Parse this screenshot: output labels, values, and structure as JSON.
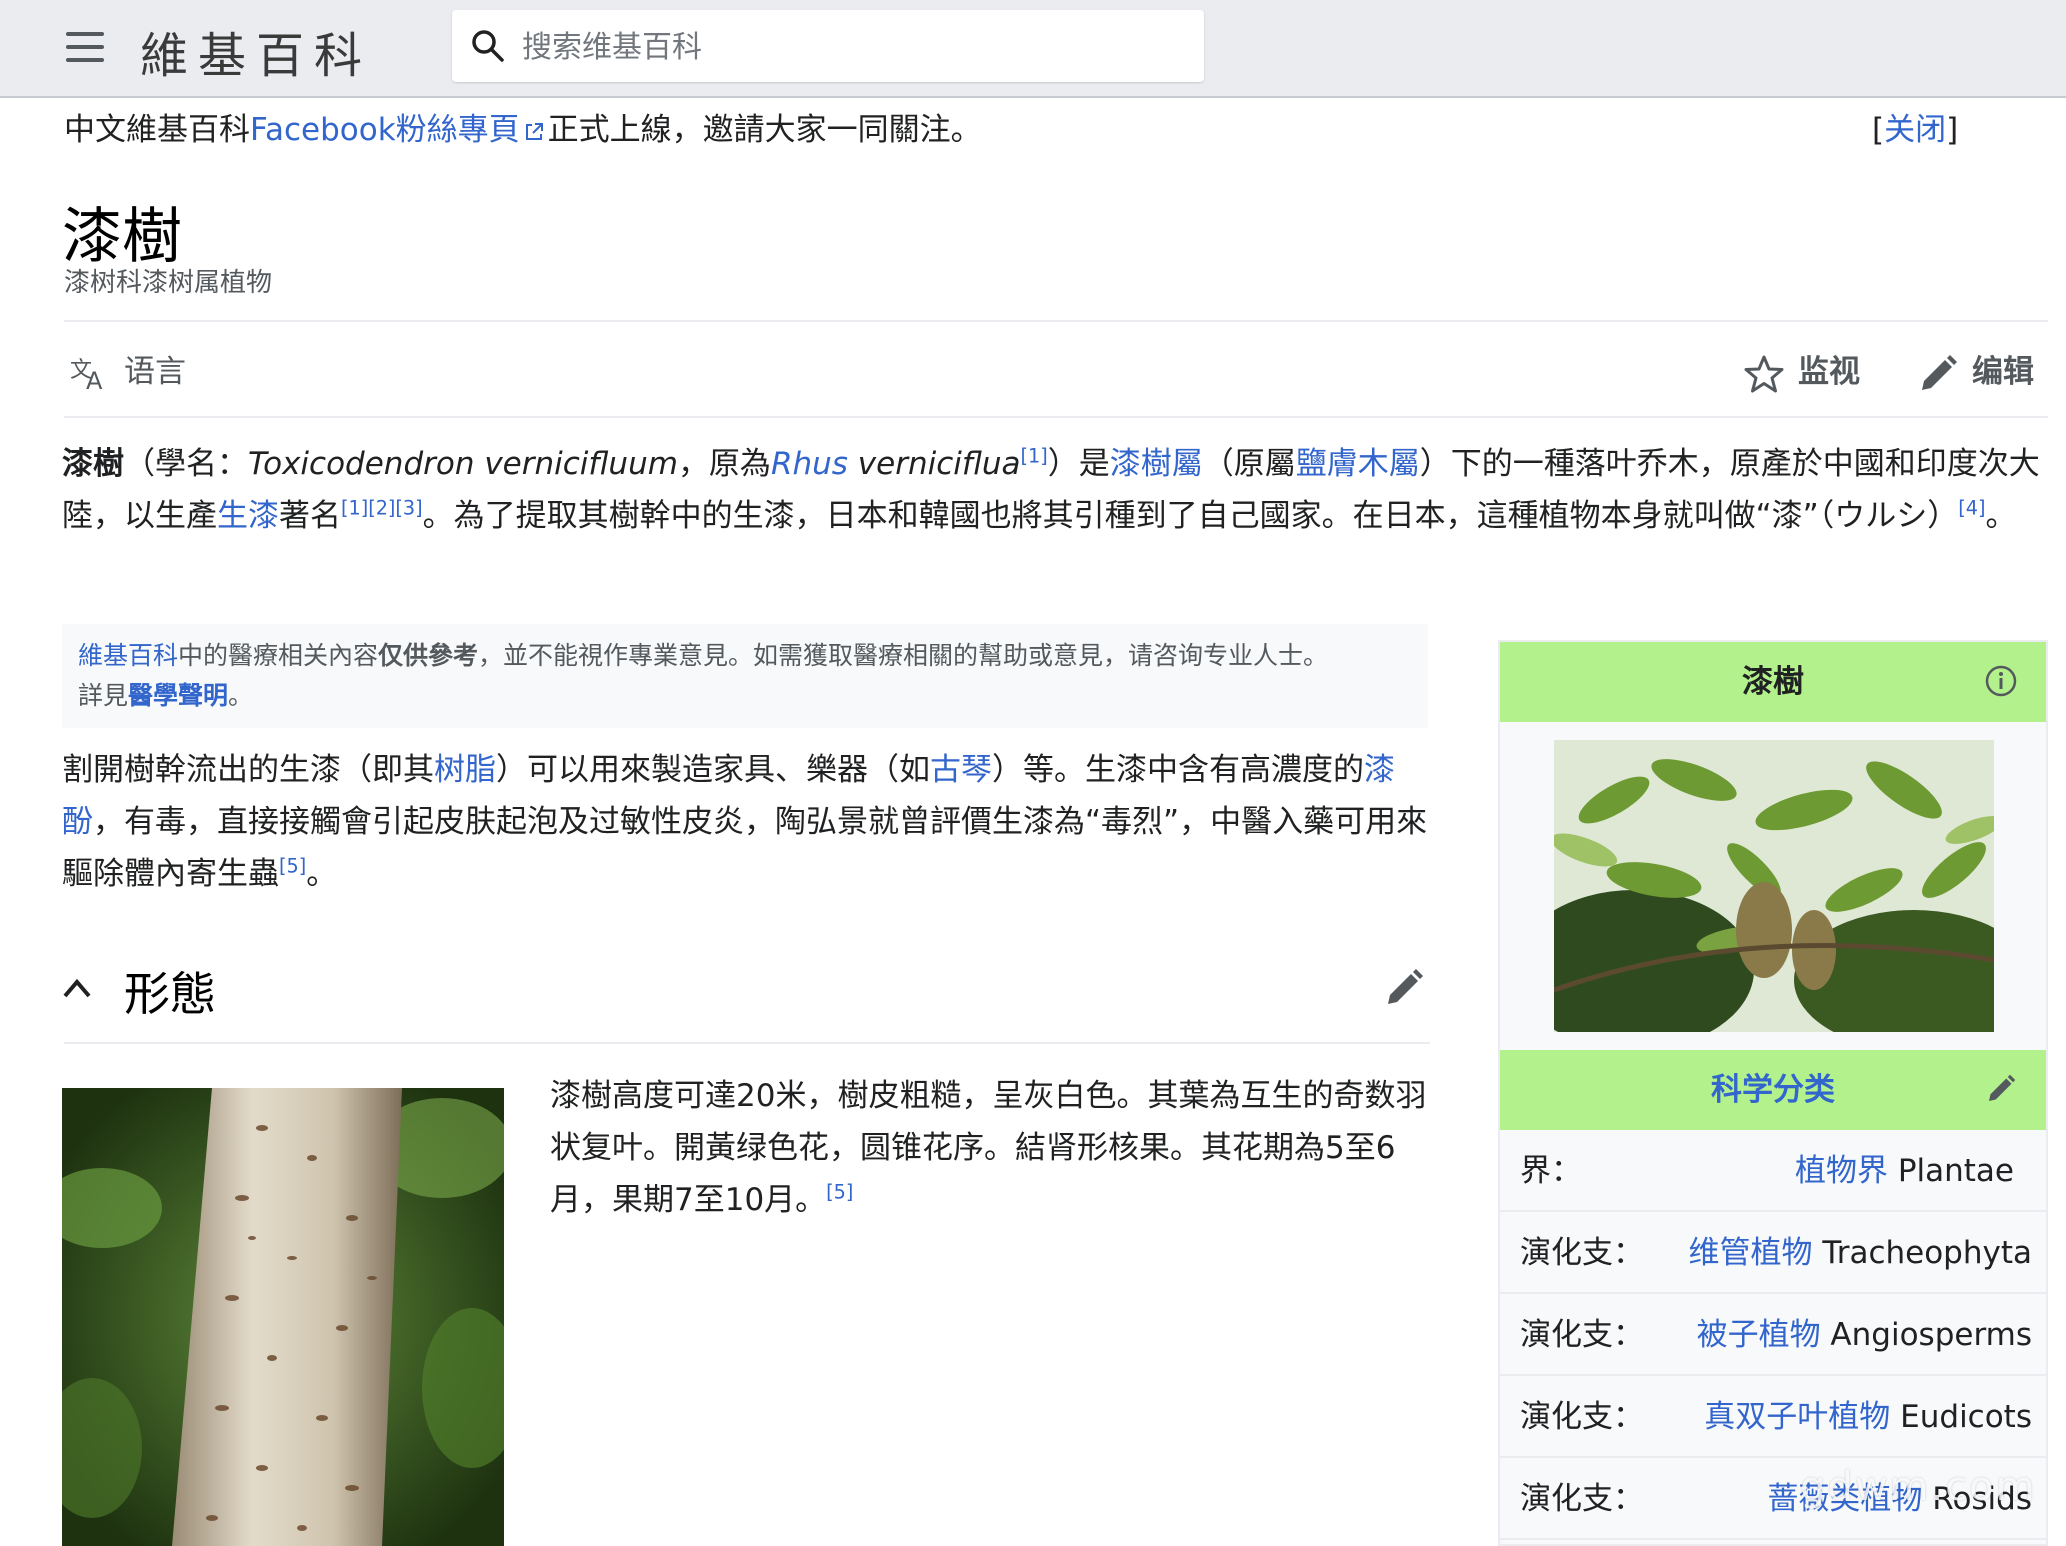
{
  "header": {
    "logo": "維基百科",
    "search_placeholder": "搜索维基百科"
  },
  "notice": {
    "prefix": "中文維基百科",
    "link": "Facebook粉絲專頁",
    "suffix": "正式上線，邀請大家一同關注。",
    "close_open": "[",
    "close_label": "关闭",
    "close_end": "]"
  },
  "page": {
    "title": "漆樹",
    "subtitle": "漆树科漆树属植物"
  },
  "actions": {
    "language": "语言",
    "watch": "监视",
    "edit": "编辑"
  },
  "lead": {
    "t1": "漆樹",
    "t2": "（學名：",
    "sci_name": "Toxicodendron vernicifluum",
    "t3": "，原為",
    "rhus": "Rhus",
    "verniciflua": " verniciflua",
    "ref1": "[1]",
    "t4": "）是",
    "link_genus": "漆樹屬",
    "t5": "（原屬",
    "link_old_genus": "鹽膚木屬",
    "t6": "）下的一種落叶乔木，原產於中國和印度次大陸，以生產",
    "link_lacquer": "生漆",
    "t7": "著名",
    "ref_multi": "[1][2][3]",
    "t8": "。為了提取其樹幹中的生漆，日本和韓國也將其引種到了自己國家。在日本，這種植物本身就叫做“漆”（ウルシ）",
    "ref4": "[4]",
    "t9": "。"
  },
  "medical": {
    "link1": "維基百科",
    "t1": "中的醫療相关內容",
    "bold": "仅供參考",
    "t2": "，並不能視作專業意見。如需獲取醫療相關的幫助或意見，请咨询专业人士。",
    "t3": "詳見",
    "link2": "醫學聲明",
    "t4": "。"
  },
  "para2": {
    "t1": "割開樹幹流出的生漆（即其",
    "link_resin": "树脂",
    "t2": "）可以用來製造家具、樂器（如",
    "link_guqin": "古琴",
    "t3": "）等。生漆中含有高濃度的",
    "link_urushiol": "漆酚",
    "t4": "，有毒，直接接觸會引起皮肤起泡及过敏性皮炎，陶弘景就曾評價生漆為“毒烈”，中醫入藥可用來驅除體內寄生蟲",
    "ref5": "[5]",
    "t5": "。"
  },
  "section": {
    "heading": "形態"
  },
  "para3": {
    "text": "漆樹高度可達20米，樹皮粗糙，呈灰白色。其葉為互生的奇数羽状复叶。開黃绿色花，圆锥花序。結肾形核果。其花期為5至6月，果期7至10月。",
    "ref5": "[5]"
  },
  "infobox": {
    "title": "漆樹",
    "taxonomy_header": "科学分类",
    "rows": [
      {
        "rank": "界：",
        "link": "植物界",
        "latin": " Plantae"
      },
      {
        "rank": "演化支：",
        "link": "维管植物",
        "latin": " Tracheophyta"
      },
      {
        "rank": "演化支：",
        "link": "被子植物",
        "latin": " Angiosperms"
      },
      {
        "rank": "演化支：",
        "link": "真双子叶植物",
        "latin": " Eudicots"
      },
      {
        "rank": "演化支：",
        "link": "蔷薇类植物",
        "latin": " Rosids"
      }
    ]
  },
  "watermark": "gdwm.com",
  "colors": {
    "link": "#3366cc",
    "infobox_header": "#b3f18c",
    "header_bg": "#eaecf0"
  },
  "icons": [
    "menu-icon",
    "search-icon",
    "external-link-icon",
    "translate-icon",
    "star-icon",
    "pencil-icon",
    "chevron-up-icon",
    "info-icon"
  ]
}
